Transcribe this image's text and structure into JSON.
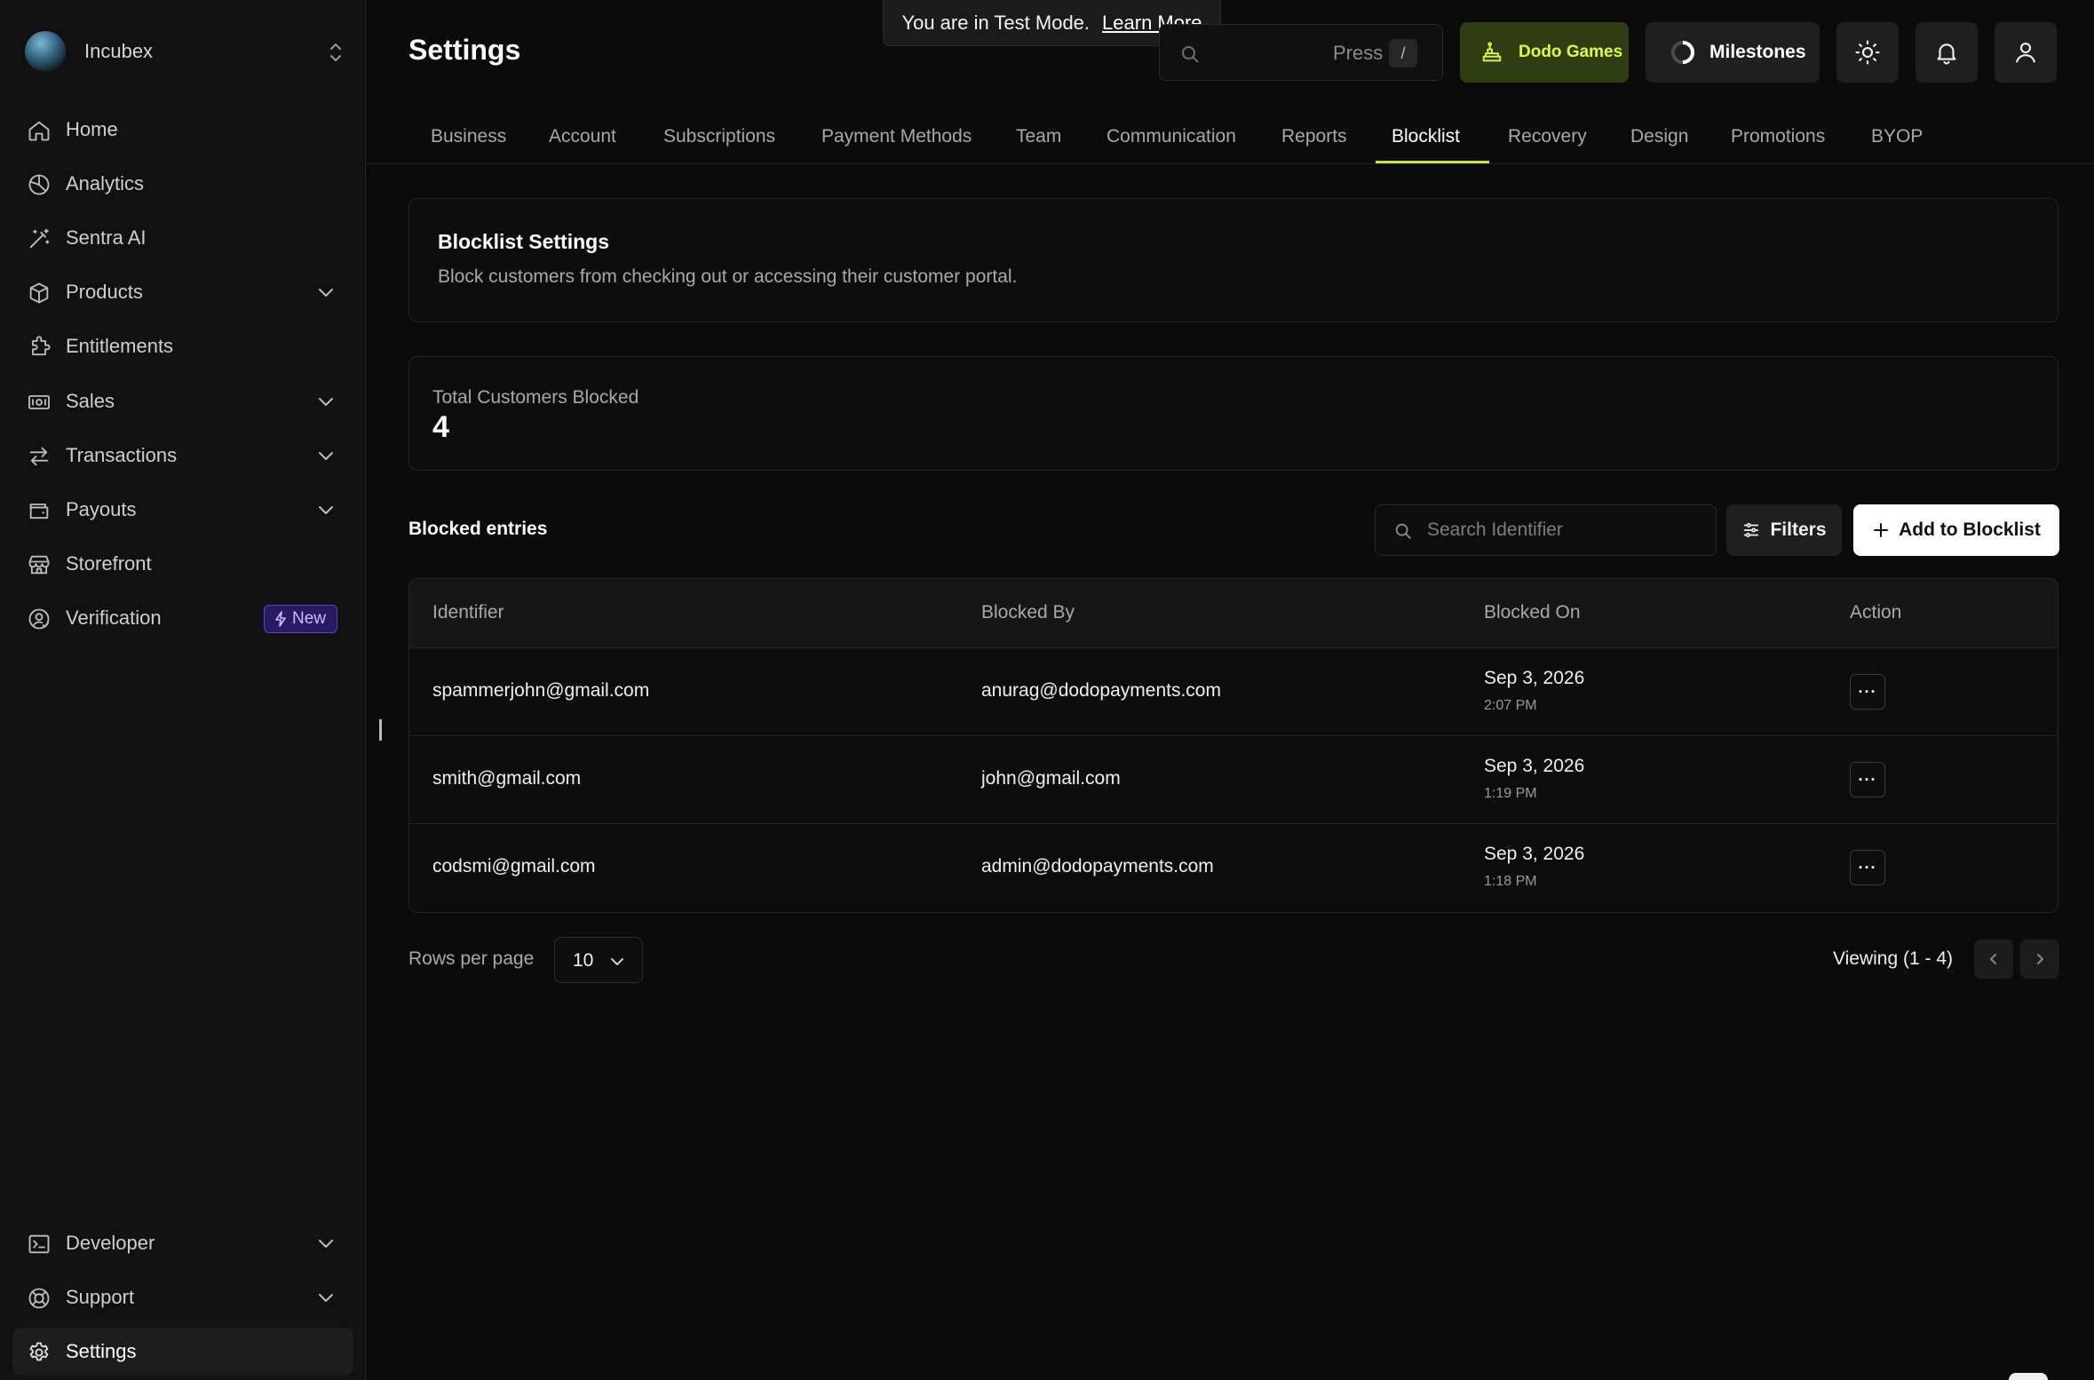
{
  "workspace": {
    "name": "Incubex"
  },
  "sidebar": {
    "items": [
      {
        "label": "Home",
        "icon": "home-icon"
      },
      {
        "label": "Analytics",
        "icon": "analytics-icon"
      },
      {
        "label": "Sentra AI",
        "icon": "magic-wand-icon"
      },
      {
        "label": "Products",
        "icon": "box-icon",
        "has_submenu": true
      },
      {
        "label": "Entitlements",
        "icon": "puzzle-icon"
      },
      {
        "label": "Sales",
        "icon": "cash-icon",
        "has_submenu": true
      },
      {
        "label": "Transactions",
        "icon": "arrows-exchange-icon",
        "has_submenu": true
      },
      {
        "label": "Payouts",
        "icon": "wallet-icon",
        "has_submenu": true
      },
      {
        "label": "Storefront",
        "icon": "store-icon"
      },
      {
        "label": "Verification",
        "icon": "user-check-icon",
        "badge": "New"
      }
    ],
    "bottom_items": [
      {
        "label": "Developer",
        "icon": "terminal-icon",
        "has_submenu": true
      },
      {
        "label": "Support",
        "icon": "lifebuoy-icon",
        "has_submenu": true
      },
      {
        "label": "Settings",
        "icon": "gear-icon",
        "active": true
      }
    ]
  },
  "header": {
    "title": "Settings",
    "test_banner": {
      "text": "You are in Test Mode.",
      "link": "Learn More"
    },
    "search": {
      "press": "Press",
      "shortcut": "/"
    },
    "dodo_games": "Dodo Games",
    "milestones": "Milestones"
  },
  "tabs": [
    {
      "label": "Business"
    },
    {
      "label": "Account"
    },
    {
      "label": "Subscriptions"
    },
    {
      "label": "Payment Methods"
    },
    {
      "label": "Team"
    },
    {
      "label": "Communication"
    },
    {
      "label": "Reports"
    },
    {
      "label": "Blocklist",
      "active": true
    },
    {
      "label": "Recovery"
    },
    {
      "label": "Design"
    },
    {
      "label": "Promotions"
    },
    {
      "label": "BYOP"
    }
  ],
  "blocklist_card": {
    "title": "Blocklist Settings",
    "description": "Block customers from checking out or accessing their customer portal."
  },
  "stats": {
    "label": "Total Customers Blocked",
    "value": "4"
  },
  "entries": {
    "title": "Blocked entries",
    "search_placeholder": "Search Identifier",
    "filters_label": "Filters",
    "add_label": "Add to Blocklist",
    "columns": [
      "Identifier",
      "Blocked By",
      "Blocked On",
      "Action"
    ],
    "rows": [
      {
        "identifier": "spammerjohn@gmail.com",
        "blocked_by": "anurag@dodopayments.com",
        "date": "Sep 3, 2026",
        "time": "2:07 PM"
      },
      {
        "identifier": "smith@gmail.com",
        "blocked_by": "john@gmail.com",
        "date": "Sep 3, 2026",
        "time": "1:19 PM"
      },
      {
        "identifier": "codsmi@gmail.com",
        "blocked_by": "admin@dodopayments.com",
        "date": "Sep 3, 2026",
        "time": "1:18 PM"
      }
    ],
    "action_glyph": "···"
  },
  "pagination": {
    "rows_per_page_label": "Rows per page",
    "rows_per_page": "10",
    "viewing": "Viewing (1 - 4)"
  },
  "colors": {
    "background": "#0b0b0b",
    "sidebar": "#111111",
    "accent_underline": "#c2e83a",
    "dodo_button_bg": "#2f3d12",
    "dodo_button_text": "#d7ff3e",
    "badge_new_bg": "#2a1a64"
  }
}
